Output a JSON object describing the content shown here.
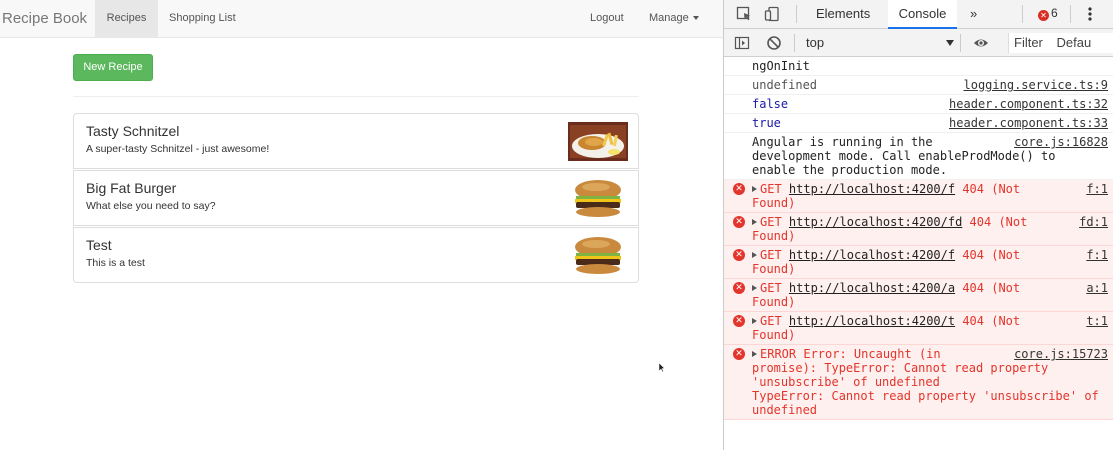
{
  "app": {
    "brand": "Recipe Book",
    "nav": {
      "recipes": "Recipes",
      "shopping_list": "Shopping List",
      "logout": "Logout",
      "manage": "Manage"
    },
    "new_recipe_button": "New Recipe",
    "recipes": [
      {
        "title": "Tasty Schnitzel",
        "description": "A super-tasty Schnitzel - just awesome!",
        "image": "schnitzel"
      },
      {
        "title": "Big Fat Burger",
        "description": "What else you need to say?",
        "image": "burger"
      },
      {
        "title": "Test",
        "description": "This is a test",
        "image": "burger"
      }
    ]
  },
  "devtools": {
    "tabs": {
      "elements": "Elements",
      "console": "Console",
      "more": "»"
    },
    "error_count": "6",
    "context": "top",
    "filter_placeholder": "Filter",
    "levels": "Defau",
    "console_lines": [
      {
        "kind": "plain",
        "text": "ngOnInit",
        "source": ""
      },
      {
        "kind": "grey",
        "text": "undefined",
        "source": "logging.service.ts:9"
      },
      {
        "kind": "blue",
        "text": "false",
        "source": "header.component.ts:32"
      },
      {
        "kind": "blue",
        "text": "true",
        "source": "header.component.ts:33"
      },
      {
        "kind": "plain",
        "text": "Angular is running in the\ndevelopment mode. Call enableProdMode() to\nenable the production mode.",
        "source": "core.js:16828"
      },
      {
        "kind": "error",
        "method": "GET",
        "url": "http://localhost:4200/f",
        "status": "404 (Not\nFound)",
        "source": "f:1"
      },
      {
        "kind": "error",
        "method": "GET",
        "url": "http://localhost:4200/fd",
        "status": "404 (Not\nFound)",
        "source": "fd:1"
      },
      {
        "kind": "error",
        "method": "GET",
        "url": "http://localhost:4200/f",
        "status": "404 (Not\nFound)",
        "source": "f:1"
      },
      {
        "kind": "error",
        "method": "GET",
        "url": "http://localhost:4200/a",
        "status": "404 (Not\nFound)",
        "source": "a:1"
      },
      {
        "kind": "error",
        "method": "GET",
        "url": "http://localhost:4200/t",
        "status": "404 (Not\nFound)",
        "source": "t:1"
      },
      {
        "kind": "error",
        "method": "",
        "url": "",
        "status": "ERROR Error: Uncaught (in\npromise): TypeError: Cannot read property\n'unsubscribe' of undefined\nTypeError: Cannot read property 'unsubscribe' of\nundefined",
        "source": "core.js:15723"
      }
    ]
  }
}
